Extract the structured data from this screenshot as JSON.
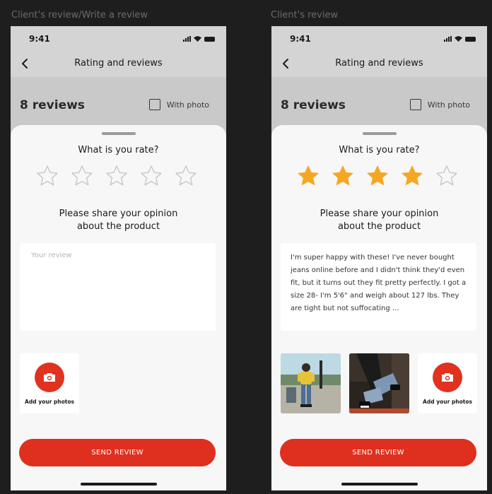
{
  "screens": [
    {
      "frame_label": "Client's review/Write a review",
      "status_time": "9:41",
      "nav_title": "Rating and reviews",
      "reviews_count": "8 reviews",
      "with_photo_label": "With photo",
      "rate_question": "What is you rate?",
      "rating": 0,
      "rating_max": 5,
      "opinion_line1": "Please share your opinion",
      "opinion_line2": "about the product",
      "review_placeholder": "Your review",
      "review_text": "",
      "add_photos_label": "Add your photos",
      "send_label": "SEND REVIEW"
    },
    {
      "frame_label": "Client's review",
      "status_time": "9:41",
      "nav_title": "Rating and reviews",
      "reviews_count": "8 reviews",
      "with_photo_label": "With photo",
      "rate_question": "What is you rate?",
      "rating": 4,
      "rating_max": 5,
      "opinion_line1": "Please share your opinion",
      "opinion_line2": "about the product",
      "review_placeholder": "",
      "review_text": "I'm super happy with these! I've never bought jeans online before and I didn't think they'd even fit, but it turns out they fit pretty perfectly. I got a size 28- I'm 5'6\" and weigh about 127 lbs. They are tight but not suffocating ...",
      "add_photos_label": "Add your photos",
      "send_label": "SEND REVIEW"
    }
  ],
  "colors": {
    "accent": "#df2f1e",
    "star_filled": "#f5a623",
    "star_empty": "#c7c7c7"
  }
}
